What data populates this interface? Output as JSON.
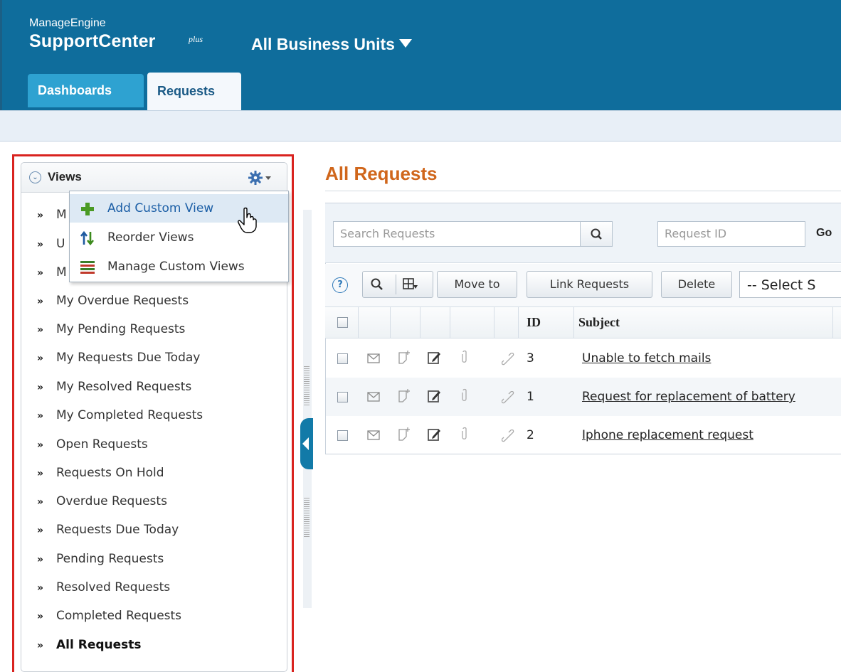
{
  "header": {
    "brand_small": "ManageEngine",
    "brand_name": "SupportCenter",
    "brand_plus": "plus",
    "business_unit": "All Business Units",
    "tabs": [
      {
        "label": "Dashboards",
        "active": false
      },
      {
        "label": "Requests",
        "active": true
      }
    ]
  },
  "views": {
    "title": "Views",
    "items": [
      {
        "label": "M"
      },
      {
        "label": "U"
      },
      {
        "label": "M"
      },
      {
        "label": "My Overdue Requests"
      },
      {
        "label": "My Pending Requests"
      },
      {
        "label": "My Requests Due Today"
      },
      {
        "label": "My Resolved Requests"
      },
      {
        "label": "My Completed Requests"
      },
      {
        "label": "Open Requests"
      },
      {
        "label": "Requests On Hold"
      },
      {
        "label": "Overdue Requests"
      },
      {
        "label": "Requests Due Today"
      },
      {
        "label": "Pending Requests"
      },
      {
        "label": "Resolved Requests"
      },
      {
        "label": "Completed Requests"
      },
      {
        "label": "All Requests",
        "active": true
      }
    ],
    "menu": [
      {
        "label": "Add Custom View",
        "icon": "plus-icon",
        "hover": true
      },
      {
        "label": "Reorder Views",
        "icon": "reorder-icon"
      },
      {
        "label": "Manage Custom Views",
        "icon": "list-icon"
      }
    ]
  },
  "main": {
    "title": "All Requests",
    "search": {
      "placeholder": "Search Requests",
      "request_id_placeholder": "Request ID",
      "go_label": "Go"
    },
    "toolbar": {
      "help": "?",
      "move_to": "Move to",
      "link_requests": "Link Requests",
      "delete": "Delete",
      "select_placeholder": "-- Select S"
    },
    "table": {
      "columns": [
        "ID",
        "Subject"
      ],
      "rows": [
        {
          "id": "3",
          "subject": "Unable to fetch mails"
        },
        {
          "id": "1",
          "subject": "Request for replacement of battery"
        },
        {
          "id": "2",
          "subject": "Iphone replacement request"
        }
      ]
    }
  },
  "colors": {
    "header_bg": "#0f6d9c",
    "title_orange": "#d0661b",
    "highlight_red": "#d9231f"
  }
}
